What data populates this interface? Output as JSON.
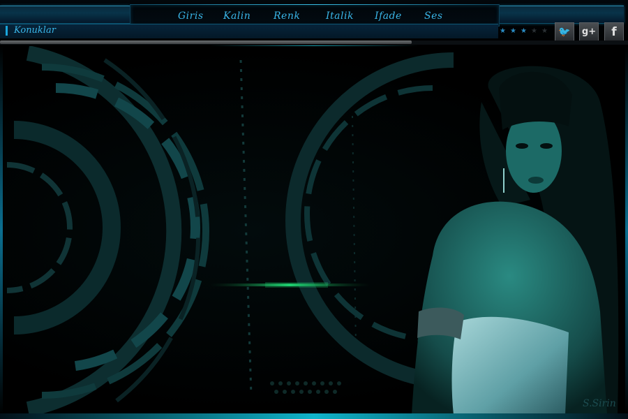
{
  "menu": {
    "items": [
      {
        "label": "Giris"
      },
      {
        "label": "Kalin"
      },
      {
        "label": "Renk"
      },
      {
        "label": "Italik"
      },
      {
        "label": "Ifade"
      },
      {
        "label": "Ses"
      }
    ]
  },
  "title_bar": {
    "title": "Konuklar"
  },
  "rating": {
    "filled_stars": 3,
    "total_stars": 5
  },
  "social": {
    "twitter_glyph": "🐦",
    "gplus_glyph": "g+",
    "facebook_glyph": "f"
  },
  "scrollbar": {
    "position_fraction": 0.66
  },
  "signature": "S.Sirin",
  "colors": {
    "accent": "#3ab6e8",
    "frame_glow": "#0fb3c9",
    "background": "#000000"
  }
}
